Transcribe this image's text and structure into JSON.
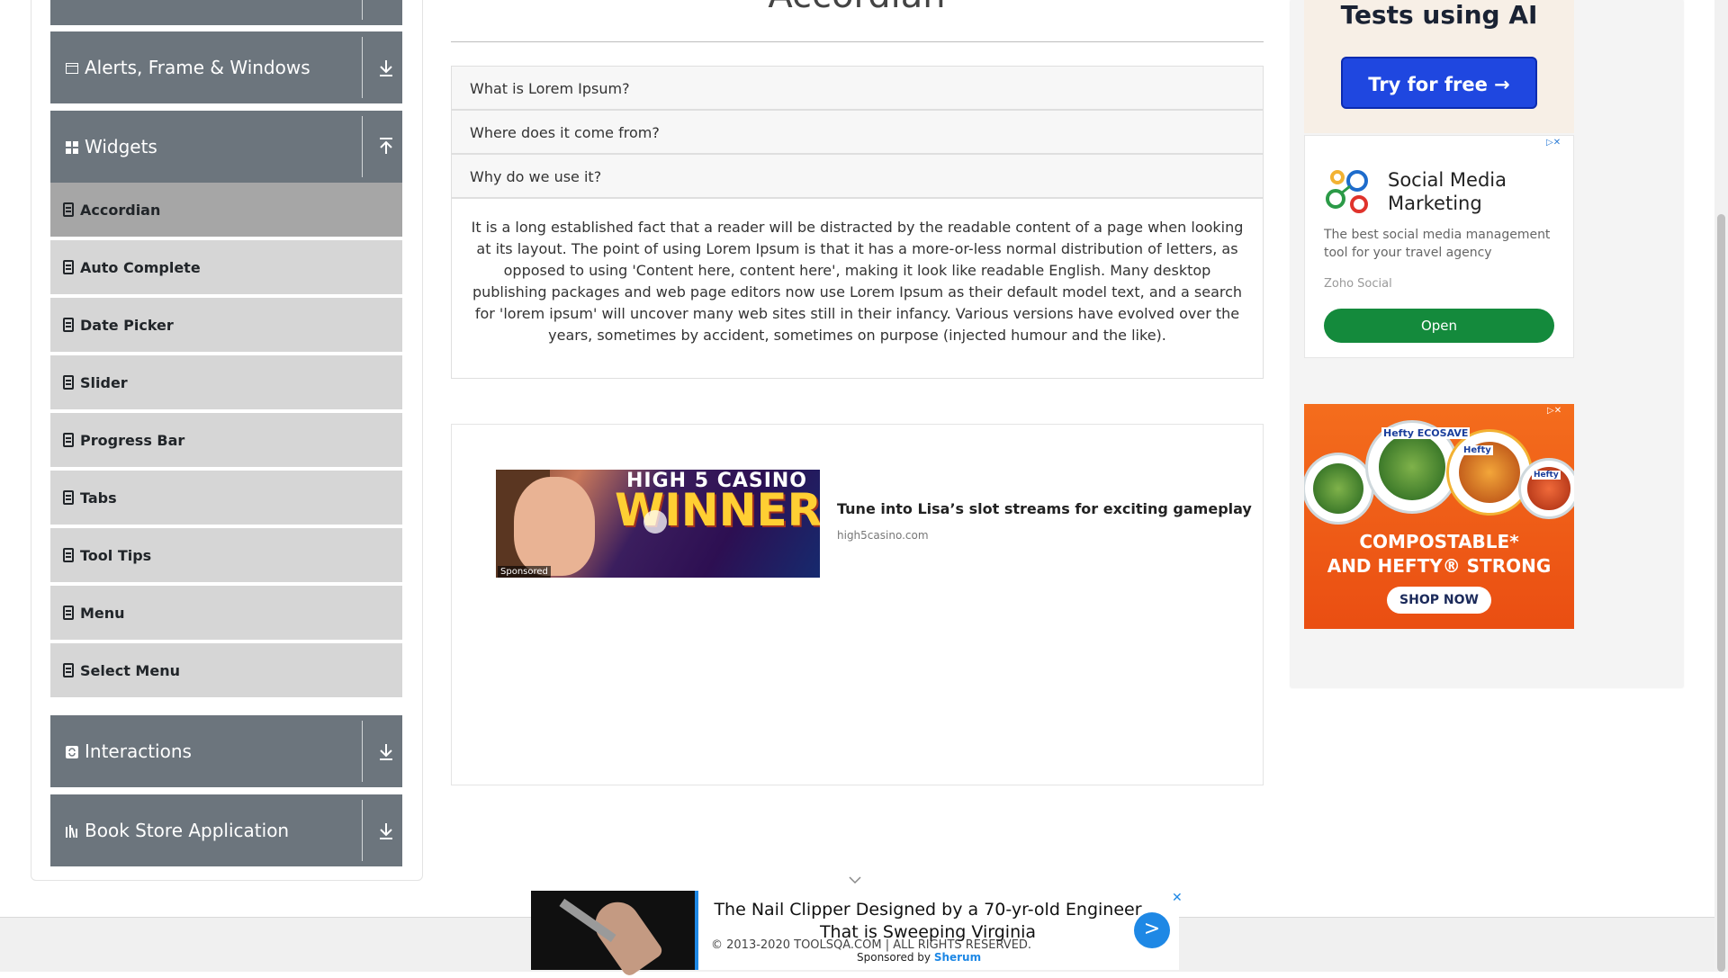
{
  "sidebar": {
    "groups": [
      {
        "label": "",
        "icon": "collapsed-group-icon",
        "arrow": "download-arrow-icon"
      },
      {
        "label": "Alerts, Frame & Windows",
        "icon": "window-icon",
        "arrow": "download-arrow-icon"
      },
      {
        "label": "Widgets",
        "icon": "grid-icon",
        "arrow": "upload-arrow-icon"
      },
      {
        "label": "Interactions",
        "icon": "refresh-square-icon",
        "arrow": "download-arrow-icon"
      },
      {
        "label": "Book Store Application",
        "icon": "books-icon",
        "arrow": "download-arrow-icon"
      }
    ],
    "items": [
      {
        "label": "Accordian",
        "active": true
      },
      {
        "label": "Auto Complete"
      },
      {
        "label": "Date Picker"
      },
      {
        "label": "Slider"
      },
      {
        "label": "Progress Bar"
      },
      {
        "label": "Tabs"
      },
      {
        "label": "Tool Tips"
      },
      {
        "label": "Menu"
      },
      {
        "label": "Select Menu"
      }
    ]
  },
  "main": {
    "title": "Accordian",
    "sections": [
      {
        "heading": "What is Lorem Ipsum?"
      },
      {
        "heading": "Where does it come from?"
      },
      {
        "heading": "Why do we use it?"
      }
    ],
    "open_body": "It is a long established fact that a reader will be distracted by the readable content of a page when looking at its layout. The point of using Lorem Ipsum is that it has a more-or-less normal distribution of letters, as opposed to using 'Content here, content here', making it look like readable English. Many desktop publishing packages and web page editors now use Lorem Ipsum as their default model text, and a search for 'lorem ipsum' will uncover many web sites still in their infancy. Various versions have evolved over the years, sometimes by accident, sometimes on purpose (injected humour and the like)."
  },
  "content_ad": {
    "image_top": "HIGH 5 CASINO",
    "image_word": "WINNER",
    "badge": "Sponsored",
    "headline": "Tune into Lisa’s slot streams for exciting gameplay",
    "domain": "high5casino.com"
  },
  "right_ads": {
    "top": {
      "title": "Tests using AI",
      "button": "Try for free →",
      "button_color": "#1f47e0"
    },
    "zoho": {
      "title": "Social Media Marketing",
      "description": "The best social media management tool for your travel agency",
      "brand": "Zoho Social",
      "button": "Open",
      "button_color": "#148a3c",
      "adchoice": "▷✕"
    },
    "hefty": {
      "plate_labels": [
        "Hefty ECOSAVE",
        "Hefty",
        "Hefty"
      ],
      "headline_1": "COMPOSTABLE*",
      "headline_2": "AND HEFTY® STRONG",
      "button": "SHOP NOW",
      "adchoice": "▷✕",
      "brand_color": "#f46d1d"
    }
  },
  "bottom_ad": {
    "headline": "The Nail Clipper Designed by a 70-yr-old Engineer That is Sweeping Virginia",
    "go": ">",
    "close": "✕",
    "accent": "#1e88e5"
  },
  "footer": {
    "copyright": "© 2013-2020 TOOLSQA.COM | ALL RIGHTS RESERVED.",
    "sponsored_prefix": "Sponsored by",
    "sponsored_brand": "Sherum"
  }
}
